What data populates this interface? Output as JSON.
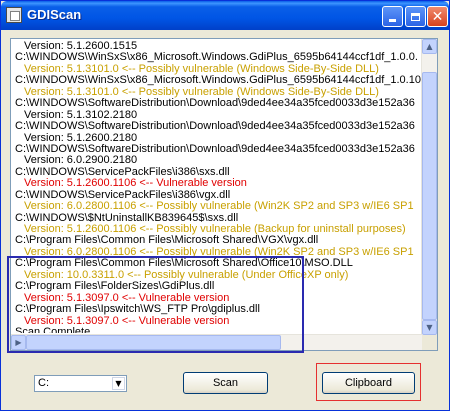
{
  "window": {
    "title": "GDIScan",
    "minimize_symbol": "_",
    "maximize_symbol": "□",
    "close_symbol": "✕"
  },
  "output": {
    "lines": [
      {
        "text": "Version: 5.1.2600.1515",
        "kind": "ver"
      },
      {
        "text": "C:\\WINDOWS\\WinSxS\\x86_Microsoft.Windows.GdiPlus_6595b64144ccf1df_1.0.0.",
        "kind": "path"
      },
      {
        "text": "Version: 5.1.3101.0 <-- Possibly vulnerable (Windows Side-By-Side DLL)",
        "kind": "possible"
      },
      {
        "text": "C:\\WINDOWS\\WinSxS\\x86_Microsoft.Windows.GdiPlus_6595b64144ccf1df_1.0.10",
        "kind": "path"
      },
      {
        "text": "Version: 5.1.3101.0 <-- Possibly vulnerable (Windows Side-By-Side DLL)",
        "kind": "possible"
      },
      {
        "text": "C:\\WINDOWS\\SoftwareDistribution\\Download\\9ded4ee34a35fced0033d3e152a36",
        "kind": "path"
      },
      {
        "text": "Version: 5.1.3102.2180",
        "kind": "ver"
      },
      {
        "text": "C:\\WINDOWS\\SoftwareDistribution\\Download\\9ded4ee34a35fced0033d3e152a36",
        "kind": "path"
      },
      {
        "text": "Version: 5.1.2600.2180",
        "kind": "ver"
      },
      {
        "text": "C:\\WINDOWS\\SoftwareDistribution\\Download\\9ded4ee34a35fced0033d3e152a36",
        "kind": "path"
      },
      {
        "text": "Version: 6.0.2900.2180",
        "kind": "ver"
      },
      {
        "text": "C:\\WINDOWS\\ServicePackFiles\\i386\\sxs.dll",
        "kind": "path"
      },
      {
        "text": "Version: 5.1.2600.1106 <-- Vulnerable version",
        "kind": "vuln"
      },
      {
        "text": "C:\\WINDOWS\\ServicePackFiles\\i386\\vgx.dll",
        "kind": "path"
      },
      {
        "text": "Version: 6.0.2800.1106 <-- Possibly vulnerable (Win2K SP2 and SP3 w/IE6 SP1",
        "kind": "possible"
      },
      {
        "text": "C:\\WINDOWS\\$NtUninstallKB839645$\\sxs.dll",
        "kind": "path"
      },
      {
        "text": "Version: 5.1.2600.1106 <-- Possibly vulnerable (Backup for uninstall purposes)",
        "kind": "possible"
      },
      {
        "text": "C:\\Program Files\\Common Files\\Microsoft Shared\\VGX\\vgx.dll",
        "kind": "path"
      },
      {
        "text": "Version: 6.0.2800.1106 <-- Possibly vulnerable (Win2K SP2 and SP3 w/IE6 SP1",
        "kind": "possible"
      },
      {
        "text": "C:\\Program Files\\Common Files\\Microsoft Shared\\Office10\\MSO.DLL",
        "kind": "path"
      },
      {
        "text": "Version: 10.0.3311.0 <-- Possibly vulnerable (Under OfficeXP only)",
        "kind": "possible"
      },
      {
        "text": "C:\\Program Files\\FolderSizes\\GdiPlus.dll",
        "kind": "path"
      },
      {
        "text": "Version: 5.1.3097.0 <-- Vulnerable version",
        "kind": "vuln"
      },
      {
        "text": "C:\\Program Files\\Ipswitch\\WS_FTP Pro\\gdiplus.dll",
        "kind": "path"
      },
      {
        "text": "Version: 5.1.3097.0 <-- Vulnerable version",
        "kind": "vuln"
      },
      {
        "text": "Scan Complete.",
        "kind": "status"
      }
    ]
  },
  "drive": {
    "selected": "C:",
    "arrow_symbol": "▼"
  },
  "buttons": {
    "scan_label": "Scan",
    "clipboard_label": "Clipboard"
  },
  "colors": {
    "possible": "#c8a000",
    "vulnerable": "#e00000",
    "annotation_blue": "#2a2ab0",
    "annotation_red": "#e53030"
  },
  "scroll": {
    "up_symbol": "▲",
    "down_symbol": "▼",
    "left_symbol": "◀",
    "right_symbol": "▶"
  }
}
